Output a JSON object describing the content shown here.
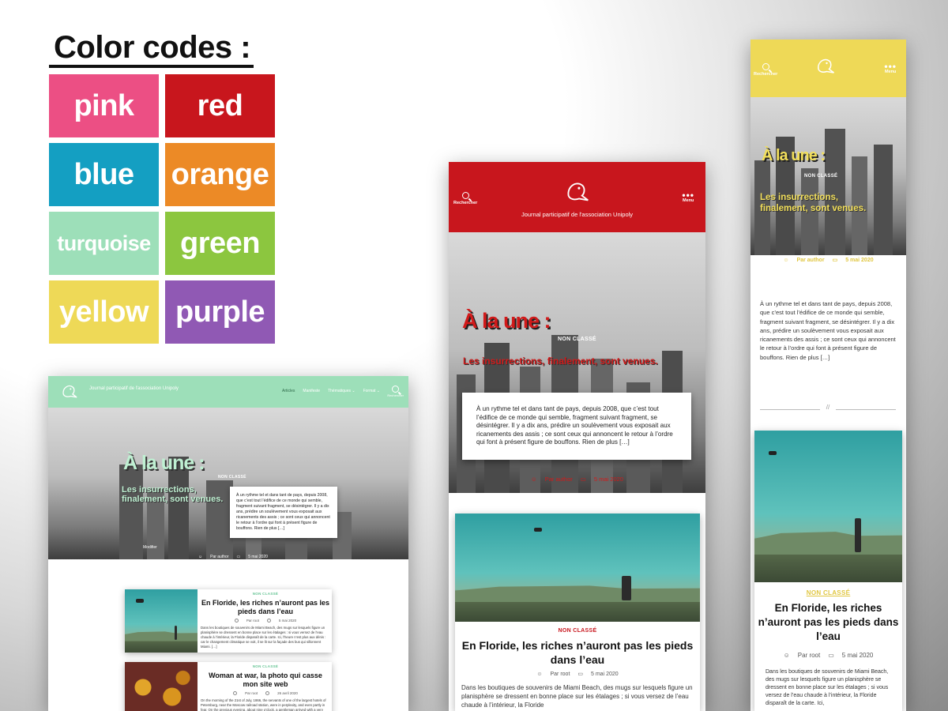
{
  "legend": {
    "title": "Color codes :",
    "swatches": [
      {
        "label": "pink",
        "color": "#ec4f84"
      },
      {
        "label": "red",
        "color": "#c8161d"
      },
      {
        "label": "blue",
        "color": "#149fc2"
      },
      {
        "label": "orange",
        "color": "#ec8a26"
      },
      {
        "label": "turquoise",
        "color": "#9ddfb9"
      },
      {
        "label": "green",
        "color": "#8cc63f"
      },
      {
        "label": "yellow",
        "color": "#eed957"
      },
      {
        "label": "purple",
        "color": "#9059b4"
      }
    ]
  },
  "site": {
    "tagline": "Journal participatif de l'association Unipoly",
    "search_label": "Rechercher",
    "menu_label": "Menu",
    "nav": [
      "Articles",
      "Manifeste",
      "Thématiques ⌄",
      "Format ⌄"
    ],
    "hero_title": "À la une :",
    "hero_category": "NON CLASSÉ",
    "hero_headline": "Les insurrections, finalement, sont venues.",
    "hero_excerpt": "À un rythme tel et dans tant de pays, depuis 2008, que c’est tout l’édifice de ce monde qui semble, fragment suivant fragment, se désintégrer. Il y a dix ans, prédire un soulèvement vous exposait aux ricanements des assis ; ce sont ceux qui annoncent le retour à l’ordre qui font à présent figure de bouffons. Rien de plus […]",
    "hero_author": "Par author",
    "hero_date": "5 mai 2020",
    "hero_extra": "Modifier",
    "divider_mark": "//"
  },
  "posts": [
    {
      "category": "NON CLASSÉ",
      "title": "En Floride, les riches n’auront pas les pieds dans l’eau",
      "author": "Par root",
      "date": "5 mai 2020",
      "date_short": "5 mai 2020",
      "excerpt": "Dans les boutiques de souvenirs de Miami Beach, des mugs sur lesquels figure un planisphère se dressent en bonne place sur les étalages : si vous versez de l’eau chaude à l’intérieur, la Floride disparaît de la carte. Ici, l’heure n’est plus aux dénis : car le changement climatique se voit, il se lit sur la façade des bus qui sillonnent Miami. […]",
      "excerpt_tablet": "Dans les boutiques de souvenirs de Miami Beach, des mugs sur lesquels figure un planisphère se dressent en bonne place sur les étalages ; si vous versez de l’eau chaude à l’intérieur, la Floride",
      "excerpt_mobile": "Dans les boutiques de souvenirs de Miami Beach, des mugs sur lesquels figure un planisphère se dressent en bonne place sur les étalages ; si vous versez de l’eau chaude à l’intérieur, la Floride disparaît de la carte. Ici,"
    },
    {
      "category": "NON CLASSÉ",
      "title": "Woman at war, la photo qui casse mon site web",
      "author": "Par root",
      "date": "26 avril 2020",
      "excerpt": "On the morning of the 21st of July, 1866, the servants of one of the largest hotels of Petersburg, near the Moscow railroad station, were in perplexity, and even partly in fear. On the previous evening, about nine o'clock, a gentleman arrived with a very"
    }
  ]
}
